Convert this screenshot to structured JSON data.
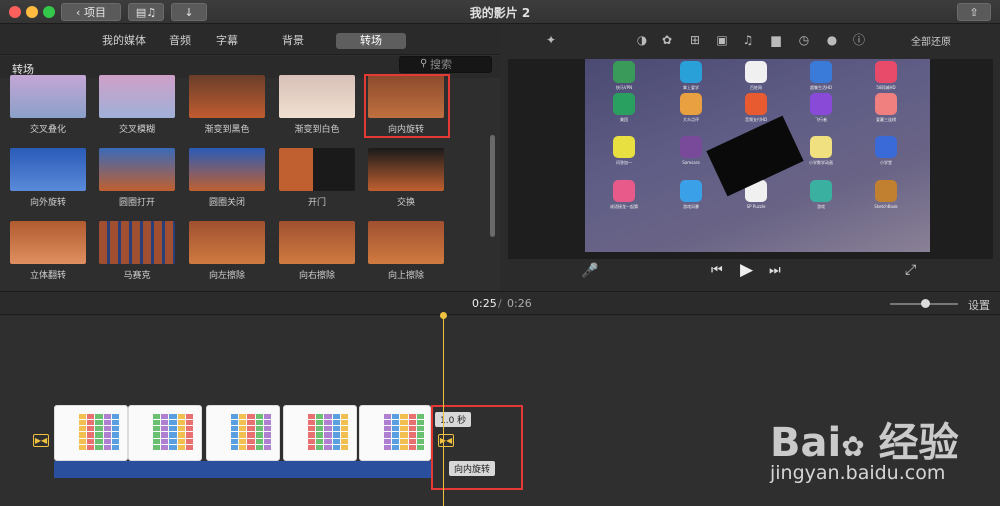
{
  "window": {
    "title": "我的影片 2",
    "back_label": "项目"
  },
  "browser": {
    "tabs": [
      {
        "label": "我的媒体"
      },
      {
        "label": "音频"
      },
      {
        "label": "字幕"
      },
      {
        "label": "背景"
      },
      {
        "label": "转场",
        "active": true
      }
    ],
    "section_title": "转场",
    "search_placeholder": "搜索",
    "transitions": [
      {
        "label": "交叉叠化"
      },
      {
        "label": "交叉模糊"
      },
      {
        "label": "渐变到黑色"
      },
      {
        "label": "渐变到白色"
      },
      {
        "label": "向内旋转",
        "selected": true
      },
      {
        "label": "向外旋转"
      },
      {
        "label": "圆圈打开"
      },
      {
        "label": "圆圈关闭"
      },
      {
        "label": "开门"
      },
      {
        "label": "交换"
      },
      {
        "label": "立体翻转"
      },
      {
        "label": "马赛克"
      },
      {
        "label": "向左擦除"
      },
      {
        "label": "向右擦除"
      },
      {
        "label": "向上擦除"
      }
    ]
  },
  "viewer": {
    "reset_all_label": "全部还原",
    "toolbar_icons": [
      "magic-wand-icon",
      "color-balance-icon",
      "color-palette-icon",
      "crop-icon",
      "stabilization-icon",
      "volume-icon",
      "equalizer-icon",
      "speed-icon",
      "filter-icon",
      "info-icon"
    ],
    "apps": [
      {
        "label": "快马VPN"
      },
      {
        "label": "掌上爱学"
      },
      {
        "label": "百姓网"
      },
      {
        "label": "超集生活HD"
      },
      {
        "label": "58同城HD"
      },
      {
        "label": "美团"
      },
      {
        "label": "大众点评"
      },
      {
        "label": "音频支付HD"
      },
      {
        "label": "飞行者"
      },
      {
        "label": "爱赢三连棋"
      },
      {
        "label": "问答加一"
      },
      {
        "label": "Samsara"
      },
      {
        "label": "QQ浏览器"
      },
      {
        "label": "小学数学动画"
      },
      {
        "label": "小学堂"
      },
      {
        "label": "成语接龙一起猜"
      },
      {
        "label": "游戏风暴"
      },
      {
        "label": "SP Puzzle"
      },
      {
        "label": "游戏"
      },
      {
        "label": "SketchBook"
      }
    ]
  },
  "playback": {
    "current_time": "0:25",
    "separator": "/",
    "total_time": "0:26",
    "settings_label": "设置"
  },
  "timeline": {
    "duration_tip": "1.0 秒",
    "transition_tip": "向内旋转"
  },
  "colors": {
    "highlight_red": "#e53935",
    "playhead": "#f0c040",
    "audio_bar": "#2a4f9c"
  }
}
